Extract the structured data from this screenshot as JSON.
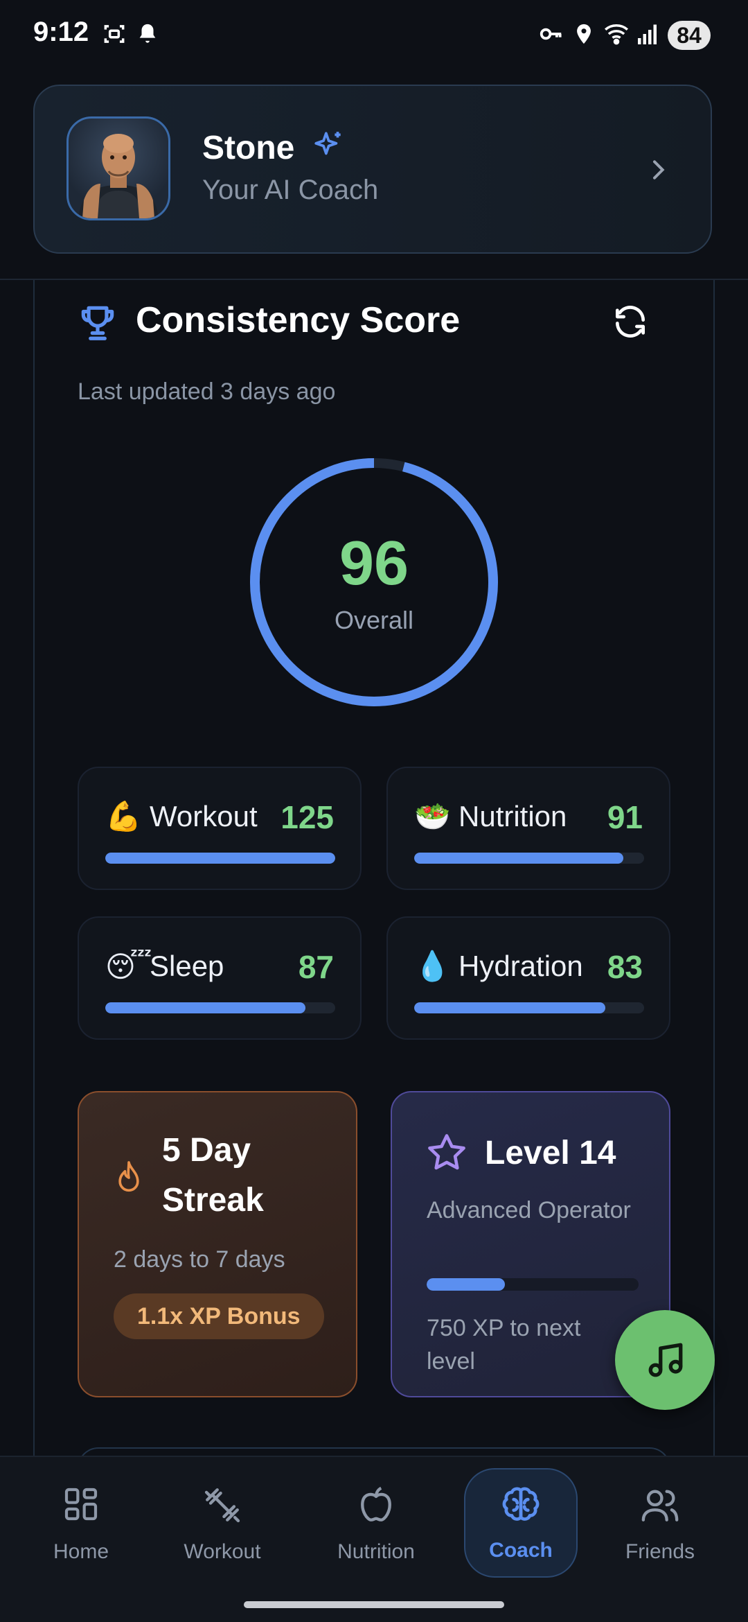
{
  "status_bar": {
    "time": "9:12",
    "battery": "84"
  },
  "coach": {
    "name": "Stone",
    "subtitle": "Your AI Coach"
  },
  "consistency": {
    "title": "Consistency Score",
    "last_updated": "Last updated 3 days ago",
    "overall_value": "96",
    "overall_label": "Overall",
    "overall_progress": 0.96
  },
  "metrics": [
    {
      "emoji": "💪",
      "label": "Workout",
      "value": "125",
      "progress": 1.0
    },
    {
      "emoji": "🥗",
      "label": "Nutrition",
      "value": "91",
      "progress": 0.91
    },
    {
      "emoji": "😴",
      "label": "Sleep",
      "value": "87",
      "progress": 0.87
    },
    {
      "emoji": "💧",
      "label": "Hydration",
      "value": "83",
      "progress": 0.83
    }
  ],
  "streak": {
    "title": "5 Day Streak",
    "subtitle": "2 days to 7 days",
    "bonus": "1.1x XP Bonus"
  },
  "level": {
    "title": "Level 14",
    "rank": "Advanced Operator",
    "progress": 0.37,
    "next": "750 XP to next level"
  },
  "bottom_nav": {
    "items": [
      {
        "label": "Home",
        "icon": "grid-icon"
      },
      {
        "label": "Workout",
        "icon": "dumbbell-icon"
      },
      {
        "label": "Nutrition",
        "icon": "apple-icon"
      },
      {
        "label": "Coach",
        "icon": "brain-icon",
        "active": true
      },
      {
        "label": "Friends",
        "icon": "users-icon"
      }
    ]
  },
  "colors": {
    "accent_blue": "#5b8ff0",
    "score_green": "#7fd68a",
    "streak_orange": "#e8904a",
    "level_purple": "#a98cf0",
    "fab_green": "#6cc06f"
  }
}
